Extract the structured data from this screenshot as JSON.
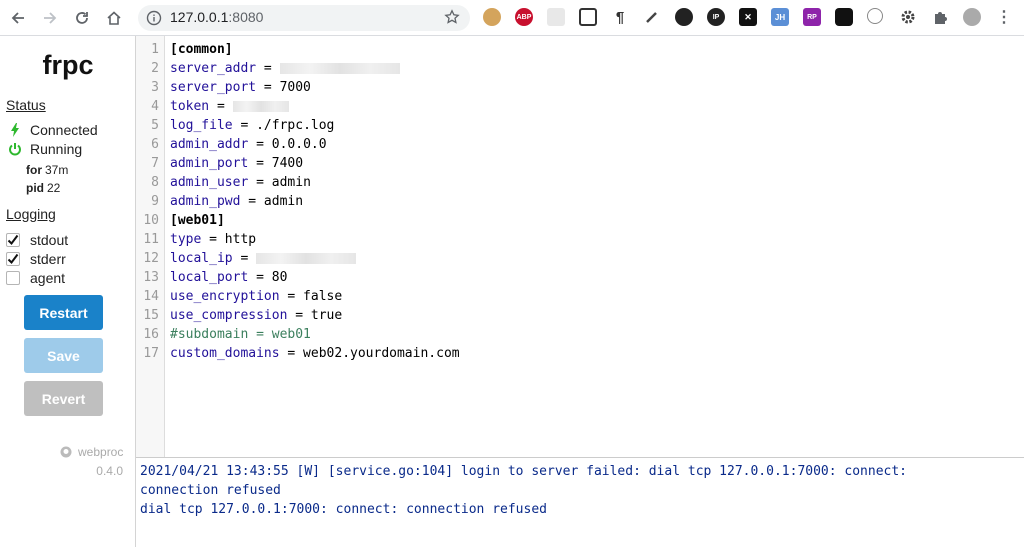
{
  "browser": {
    "url_host": "127.0.0.1",
    "url_port": ":8080"
  },
  "sidebar": {
    "title": "frpc",
    "status_heading": "Status",
    "status_connected": "Connected",
    "status_running": "Running",
    "for_label": "for",
    "for_value": "37m",
    "pid_label": "pid",
    "pid_value": "22",
    "logging_heading": "Logging",
    "logging": [
      {
        "label": "stdout",
        "checked": true
      },
      {
        "label": "stderr",
        "checked": true
      },
      {
        "label": "agent",
        "checked": false
      }
    ],
    "restart_label": "Restart",
    "save_label": "Save",
    "revert_label": "Revert",
    "footer_link": "webproc",
    "version": "0.4.0"
  },
  "editor": {
    "line_numbers": [
      "1",
      "2",
      "3",
      "4",
      "5",
      "6",
      "7",
      "8",
      "9",
      "10",
      "11",
      "12",
      "13",
      "14",
      "15",
      "16",
      "17"
    ],
    "lines": [
      {
        "key": "[common]"
      },
      {
        "key": "server_addr",
        "value": " = "
      },
      {
        "key": "server_port",
        "value": " = 7000"
      },
      {
        "key": "token",
        "value": " = "
      },
      {
        "key": "log_file",
        "value": " = ./frpc.log"
      },
      {
        "key": "admin_addr",
        "value": " = 0.0.0.0"
      },
      {
        "key": "admin_port",
        "value": " = 7400"
      },
      {
        "key": "admin_user",
        "value": " = admin"
      },
      {
        "key": "admin_pwd",
        "value": " = admin"
      },
      {
        "key": "[web01]"
      },
      {
        "key": "type",
        "value": " = http"
      },
      {
        "key": "local_ip",
        "value": " = "
      },
      {
        "key": "local_port",
        "value": " = 80"
      },
      {
        "key": "use_encryption",
        "value": " = false"
      },
      {
        "key": "use_compression",
        "value": " = true"
      },
      {
        "key": "#subdomain = web01"
      },
      {
        "key": "custom_domains",
        "value": " = web02.yourdomain.com"
      }
    ]
  },
  "log": {
    "lines": [
      "2021/04/21 13:43:55 [W] [service.go:104] login to server failed: dial tcp 127.0.0.1:7000: connect:",
      "connection refused",
      "dial tcp 127.0.0.1:7000: connect: connection refused"
    ]
  }
}
